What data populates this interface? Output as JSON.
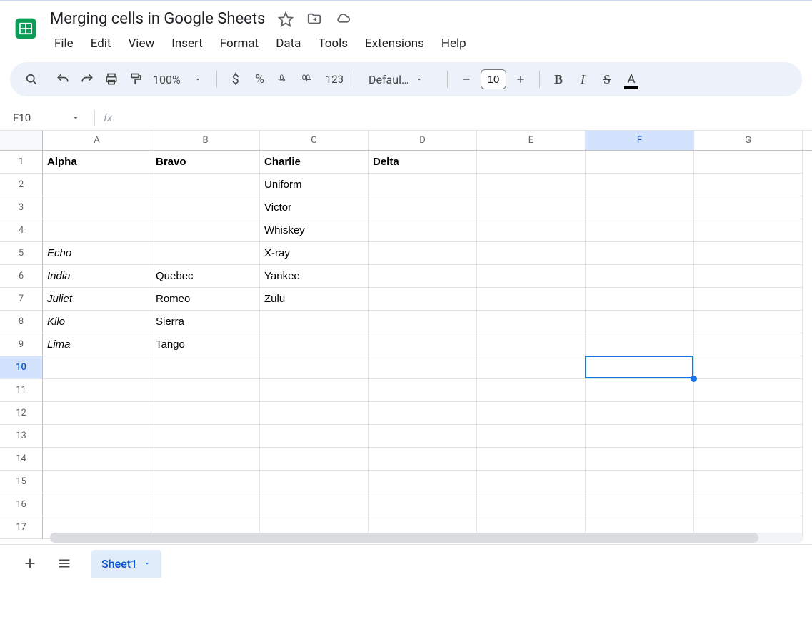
{
  "doc": {
    "title": "Merging cells in Google Sheets"
  },
  "menu": [
    "File",
    "Edit",
    "View",
    "Insert",
    "Format",
    "Data",
    "Tools",
    "Extensions",
    "Help"
  ],
  "toolbar": {
    "zoom": "100%",
    "font_name": "Defaul…",
    "font_size": "10"
  },
  "namebox": {
    "cell_ref": "F10"
  },
  "columns": [
    "A",
    "B",
    "C",
    "D",
    "E",
    "F",
    "G"
  ],
  "selected_column_index": 5,
  "row_count": 17,
  "selected_row": 10,
  "cells": {
    "r1": {
      "A": "Alpha",
      "B": "Bravo",
      "C": "Charlie",
      "D": "Delta"
    },
    "r2": {
      "C": "Uniform"
    },
    "r3": {
      "C": "Victor"
    },
    "r4": {
      "C": "Whiskey"
    },
    "r5": {
      "A": "Echo",
      "C": "X-ray"
    },
    "r6": {
      "A": "India",
      "B": "Quebec",
      "C": "Yankee"
    },
    "r7": {
      "A": "Juliet",
      "B": "Romeo",
      "C": "Zulu"
    },
    "r8": {
      "A": "Kilo",
      "B": "Sierra"
    },
    "r9": {
      "A": "Lima",
      "B": "Tango"
    }
  },
  "bold_cells": [
    "r1.A",
    "r1.B",
    "r1.C",
    "r1.D"
  ],
  "italic_cells": [
    "r5.A",
    "r6.A",
    "r7.A",
    "r8.A",
    "r9.A"
  ],
  "sheet_tab": "Sheet1"
}
